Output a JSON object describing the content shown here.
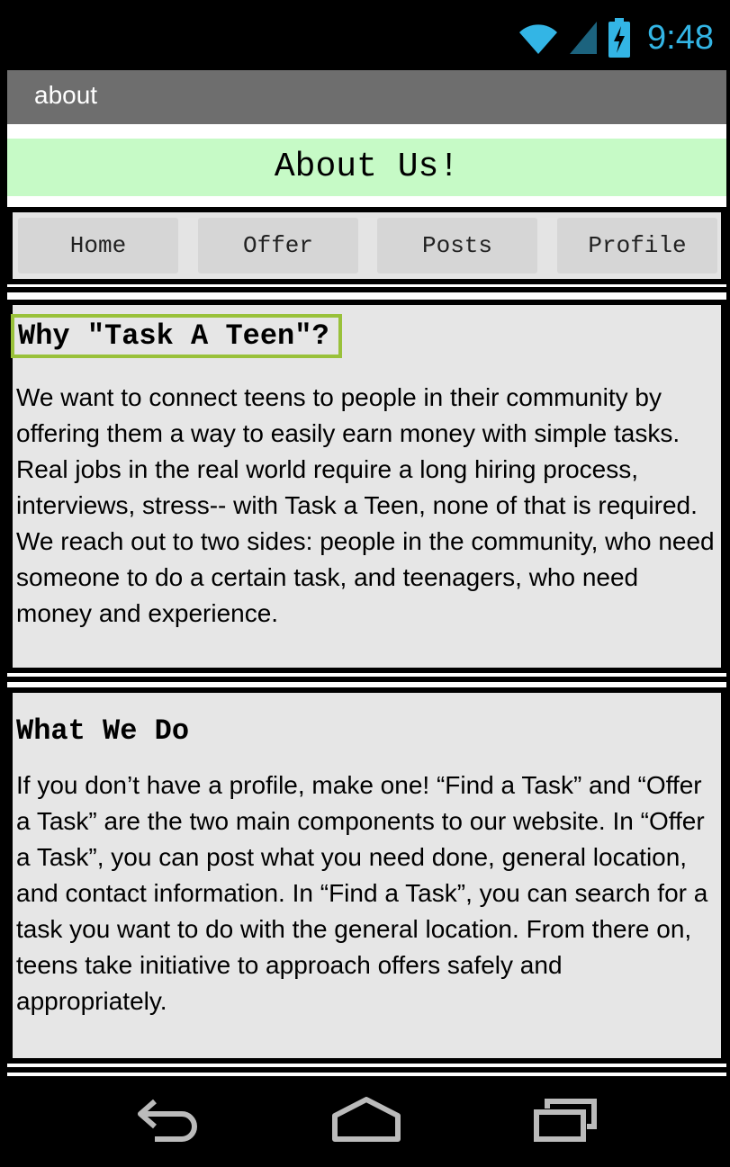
{
  "status_bar": {
    "time": "9:48",
    "accent_color": "#33b5e5",
    "icons": [
      "wifi-icon",
      "cell-signal-icon",
      "battery-charging-icon"
    ]
  },
  "action_bar": {
    "title": "about"
  },
  "banner": {
    "title": "About Us!",
    "color": "#c6fac6"
  },
  "nav": {
    "buttons": [
      "Home",
      "Offer",
      "Posts",
      "Profile"
    ]
  },
  "section1": {
    "heading": "Why \"Task A Teen\"?",
    "body": "We want to connect teens to people in their community by offering them a way to easily earn money with simple tasks. Real jobs in the real world require a long hiring process, interviews, stress-- with Task a Teen, none of that is required. We reach out to two sides: people in the community, who need someone to do a certain task, and teenagers, who need money and experience."
  },
  "section2": {
    "heading": "What We Do",
    "body": "If you don’t have a profile, make one! “Find a Task” and “Offer a Task” are the two main components to our website. In “Offer a Task”, you can post what you need done, general location, and contact information. In “Find a Task”, you can search for a task you want to do with the general location. From there on, teens take initiative to approach offers safely and appropriately."
  },
  "system_nav": {
    "icons": [
      "back-icon",
      "home-icon",
      "recent-apps-icon"
    ]
  }
}
